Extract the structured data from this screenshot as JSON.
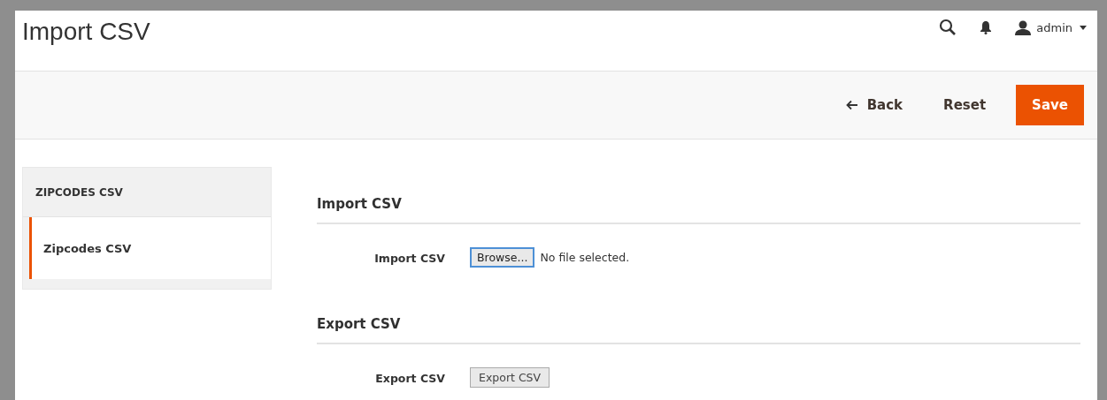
{
  "page_title": "Import CSV",
  "header": {
    "user": "admin"
  },
  "actions": [
    {
      "kind": "back",
      "label": "Back"
    },
    {
      "kind": "plain",
      "label": "Reset"
    },
    {
      "kind": "primary",
      "label": "Save"
    }
  ],
  "sidebar": {
    "title": "ZIPCODES CSV",
    "items": [
      {
        "label": "Zipcodes CSV",
        "selected": true
      }
    ]
  },
  "sections": [
    {
      "title": "Import CSV",
      "field": {
        "kind": "file",
        "label": "Import CSV",
        "button": "Browse...",
        "status": "No file selected."
      }
    },
    {
      "title": "Export CSV",
      "field": {
        "kind": "button",
        "label": "Export CSV",
        "button": "Export CSV"
      }
    }
  ]
}
